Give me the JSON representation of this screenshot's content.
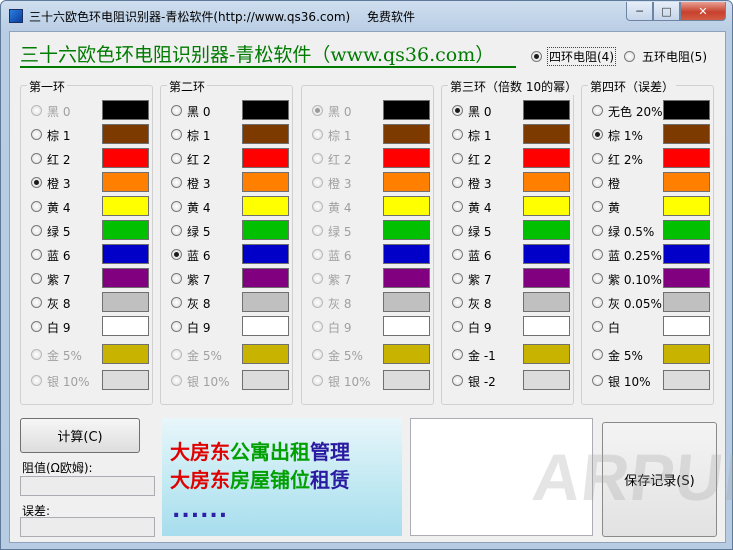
{
  "window": {
    "title": "三十六欧色环电阻识别器-青松软件(http://www.qs36.com)",
    "title_extra": "免费软件",
    "minimize_label": "─",
    "maximize_label": "□",
    "close_label": "✕"
  },
  "header": {
    "headline": "三十六欧色环电阻识别器-青松软件（www.qs36.com）",
    "mode_options": [
      {
        "label": "四环电阻(4)",
        "selected": true
      },
      {
        "label": "五环电阻(5)",
        "selected": false
      }
    ]
  },
  "colors": {
    "black": "#000000",
    "brown": "#7d3a00",
    "red": "#ff0000",
    "orange": "#ff8000",
    "yellow": "#ffff00",
    "green": "#00c000",
    "blue": "#0000c8",
    "purple": "#800080",
    "grey": "#c0c0c0",
    "white": "#ffffff",
    "gold": "#c8b400",
    "silver": "#dcdcdc"
  },
  "groups": [
    {
      "title": "第一环",
      "rows": [
        {
          "label": "黑 0",
          "color": "#000000",
          "checked": false,
          "disabled": true
        },
        {
          "label": "棕 1",
          "color": "#7d3a00",
          "checked": false,
          "disabled": false
        },
        {
          "label": "红 2",
          "color": "#ff0000",
          "checked": false,
          "disabled": false
        },
        {
          "label": "橙 3",
          "color": "#ff8000",
          "checked": true,
          "disabled": false
        },
        {
          "label": "黄 4",
          "color": "#ffff00",
          "checked": false,
          "disabled": false
        },
        {
          "label": "绿 5",
          "color": "#00c000",
          "checked": false,
          "disabled": false
        },
        {
          "label": "蓝 6",
          "color": "#0000c8",
          "checked": false,
          "disabled": false
        },
        {
          "label": "紫 7",
          "color": "#800080",
          "checked": false,
          "disabled": false
        },
        {
          "label": "灰 8",
          "color": "#c0c0c0",
          "checked": false,
          "disabled": false
        },
        {
          "label": "白 9",
          "color": "#ffffff",
          "checked": false,
          "disabled": false
        },
        {
          "label": "金 5%",
          "color": "#c8b400",
          "checked": false,
          "disabled": true
        },
        {
          "label": "银 10%",
          "color": "#dcdcdc",
          "checked": false,
          "disabled": true
        }
      ]
    },
    {
      "title": "第二环",
      "rows": [
        {
          "label": "黑 0",
          "color": "#000000",
          "checked": false,
          "disabled": false
        },
        {
          "label": "棕 1",
          "color": "#7d3a00",
          "checked": false,
          "disabled": false
        },
        {
          "label": "红 2",
          "color": "#ff0000",
          "checked": false,
          "disabled": false
        },
        {
          "label": "橙 3",
          "color": "#ff8000",
          "checked": false,
          "disabled": false
        },
        {
          "label": "黄 4",
          "color": "#ffff00",
          "checked": false,
          "disabled": false
        },
        {
          "label": "绿 5",
          "color": "#00c000",
          "checked": false,
          "disabled": false
        },
        {
          "label": "蓝 6",
          "color": "#0000c8",
          "checked": true,
          "disabled": false
        },
        {
          "label": "紫 7",
          "color": "#800080",
          "checked": false,
          "disabled": false
        },
        {
          "label": "灰 8",
          "color": "#c0c0c0",
          "checked": false,
          "disabled": false
        },
        {
          "label": "白 9",
          "color": "#ffffff",
          "checked": false,
          "disabled": false
        },
        {
          "label": "金 5%",
          "color": "#c8b400",
          "checked": false,
          "disabled": true
        },
        {
          "label": "银 10%",
          "color": "#dcdcdc",
          "checked": false,
          "disabled": true
        }
      ]
    },
    {
      "title": "",
      "rows": [
        {
          "label": "黑 0",
          "color": "#000000",
          "checked": true,
          "disabled": true
        },
        {
          "label": "棕 1",
          "color": "#7d3a00",
          "checked": false,
          "disabled": true
        },
        {
          "label": "红 2",
          "color": "#ff0000",
          "checked": false,
          "disabled": true
        },
        {
          "label": "橙 3",
          "color": "#ff8000",
          "checked": false,
          "disabled": true
        },
        {
          "label": "黄 4",
          "color": "#ffff00",
          "checked": false,
          "disabled": true
        },
        {
          "label": "绿 5",
          "color": "#00c000",
          "checked": false,
          "disabled": true
        },
        {
          "label": "蓝 6",
          "color": "#0000c8",
          "checked": false,
          "disabled": true
        },
        {
          "label": "紫 7",
          "color": "#800080",
          "checked": false,
          "disabled": true
        },
        {
          "label": "灰 8",
          "color": "#c0c0c0",
          "checked": false,
          "disabled": true
        },
        {
          "label": "白 9",
          "color": "#ffffff",
          "checked": false,
          "disabled": true
        },
        {
          "label": "金 5%",
          "color": "#c8b400",
          "checked": false,
          "disabled": true
        },
        {
          "label": "银 10%",
          "color": "#dcdcdc",
          "checked": false,
          "disabled": true
        }
      ]
    },
    {
      "title": "第三环（倍数 10的幂）",
      "rows": [
        {
          "label": "黑 0",
          "color": "#000000",
          "checked": true,
          "disabled": false
        },
        {
          "label": "棕 1",
          "color": "#7d3a00",
          "checked": false,
          "disabled": false
        },
        {
          "label": "红 2",
          "color": "#ff0000",
          "checked": false,
          "disabled": false
        },
        {
          "label": "橙 3",
          "color": "#ff8000",
          "checked": false,
          "disabled": false
        },
        {
          "label": "黄 4",
          "color": "#ffff00",
          "checked": false,
          "disabled": false
        },
        {
          "label": "绿 5",
          "color": "#00c000",
          "checked": false,
          "disabled": false
        },
        {
          "label": "蓝 6",
          "color": "#0000c8",
          "checked": false,
          "disabled": false
        },
        {
          "label": "紫 7",
          "color": "#800080",
          "checked": false,
          "disabled": false
        },
        {
          "label": "灰 8",
          "color": "#c0c0c0",
          "checked": false,
          "disabled": false
        },
        {
          "label": "白 9",
          "color": "#ffffff",
          "checked": false,
          "disabled": false
        },
        {
          "label": "金 -1",
          "color": "#c8b400",
          "checked": false,
          "disabled": false
        },
        {
          "label": "银 -2",
          "color": "#dcdcdc",
          "checked": false,
          "disabled": false
        }
      ]
    },
    {
      "title": "第四环（误差）",
      "rows": [
        {
          "label": "无色 20%",
          "color": "#000000",
          "checked": false,
          "disabled": false
        },
        {
          "label": "棕 1%",
          "color": "#7d3a00",
          "checked": true,
          "disabled": false
        },
        {
          "label": "红 2%",
          "color": "#ff0000",
          "checked": false,
          "disabled": false
        },
        {
          "label": "橙",
          "color": "#ff8000",
          "checked": false,
          "disabled": false
        },
        {
          "label": "黄",
          "color": "#ffff00",
          "checked": false,
          "disabled": false
        },
        {
          "label": "绿 0.5%",
          "color": "#00c000",
          "checked": false,
          "disabled": false
        },
        {
          "label": "蓝 0.25%",
          "color": "#0000c8",
          "checked": false,
          "disabled": false
        },
        {
          "label": "紫 0.10%",
          "color": "#800080",
          "checked": false,
          "disabled": false
        },
        {
          "label": "灰 0.05%",
          "color": "#c0c0c0",
          "checked": false,
          "disabled": false
        },
        {
          "label": "白",
          "color": "#ffffff",
          "checked": false,
          "disabled": false
        },
        {
          "label": "金 5%",
          "color": "#c8b400",
          "checked": false,
          "disabled": false
        },
        {
          "label": "银 10%",
          "color": "#dcdcdc",
          "checked": false,
          "disabled": false
        }
      ]
    }
  ],
  "calc": {
    "button_label": "计算(C)",
    "resistance_label": "阻值(Ω欧姆):",
    "resistance_value": "",
    "tolerance_label": "误差:",
    "tolerance_value": ""
  },
  "ad": {
    "line1": [
      {
        "text": "大房东",
        "color": "#e00000"
      },
      {
        "text": "公寓出租",
        "color": "#00a000"
      },
      {
        "text": "管理",
        "color": "#2a1aa0"
      }
    ],
    "line2": [
      {
        "text": "大房东",
        "color": "#e00000"
      },
      {
        "text": "房屋铺位",
        "color": "#00a000"
      },
      {
        "text": "租赁",
        "color": "#2a1aa0"
      }
    ],
    "dots": "......"
  },
  "save": {
    "button_label": "保存记录(S)"
  },
  "watermark": "ARPUN"
}
